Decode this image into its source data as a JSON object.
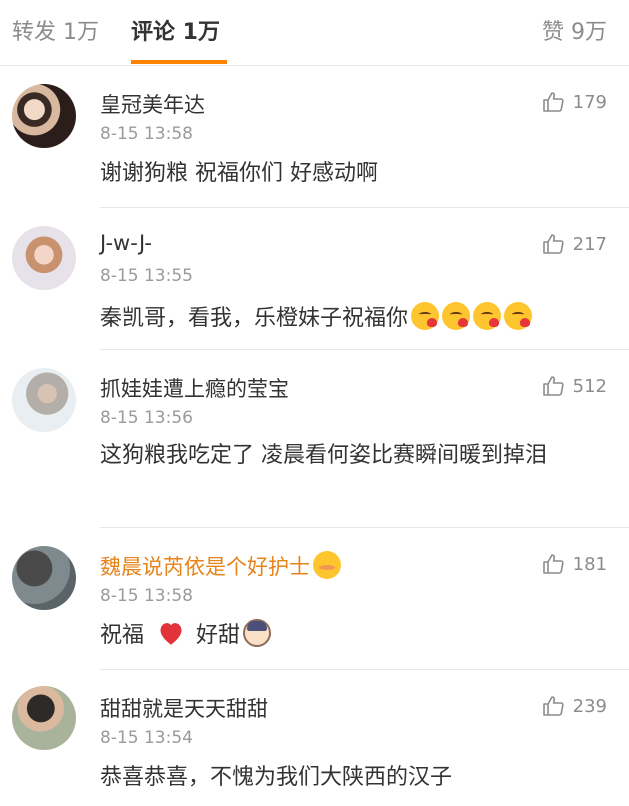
{
  "tabs": {
    "repost": "转发 1万",
    "comments": "评论 1万",
    "likes": "赞 9万",
    "active_color": "#ff8200"
  },
  "comments": [
    {
      "username": "皇冠美年达",
      "timestamp": "8-15 13:58",
      "text": "谢谢狗粮 祝福你们 好感动啊",
      "likes": "179"
    },
    {
      "username": "J-w-J-",
      "timestamp": "8-15 13:55",
      "text": "秦凯哥，看我，乐橙妹子祝福你",
      "emojis": [
        "kiss-emoji",
        "kiss-emoji",
        "kiss-emoji",
        "kiss-emoji"
      ],
      "likes": "217"
    },
    {
      "username": "抓娃娃遭上瘾的莹宝",
      "timestamp": "8-15 13:56",
      "text": "这狗粮我吃定了  凌晨看何姿比赛瞬间暖到掉泪",
      "likes": "512"
    },
    {
      "username": "魏晨说芮依是个好护士",
      "username_color": "#e6841a",
      "username_badge": "blush-emoji",
      "timestamp": "8-15 13:58",
      "text_part1": "祝福",
      "text_part2": "好甜",
      "emojis": [
        "heart-icon",
        "boy-emoji"
      ],
      "likes": "181"
    },
    {
      "username": "甜甜就是天天甜甜",
      "timestamp": "8-15 13:54",
      "text": "恭喜恭喜，不愧为我们大陕西的汉子",
      "likes": "239"
    }
  ]
}
